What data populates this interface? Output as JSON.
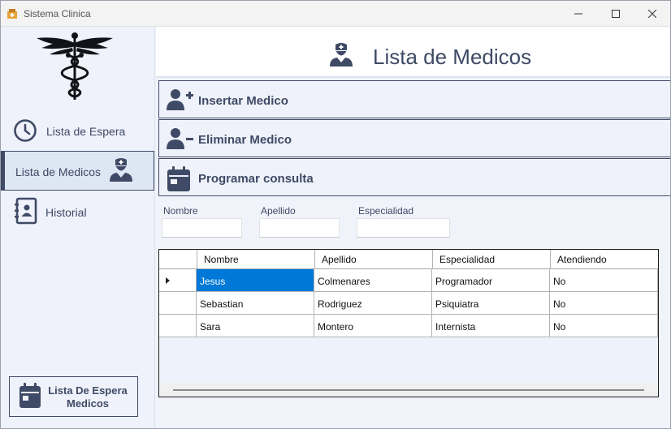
{
  "window": {
    "title": "Sistema Clinica",
    "controls": {
      "minimize": "─",
      "maximize": "☐",
      "close": "✕"
    }
  },
  "colors": {
    "accent": "#3f4a66",
    "selection": "#0078d7",
    "sidebar_bg": "#eff2fa",
    "active_nav_bg": "#dde6f3"
  },
  "sidebar": {
    "logo_icon": "caduceus-icon",
    "items": [
      {
        "label": "Lista de Espera",
        "icon": "clock-icon",
        "active": false
      },
      {
        "label": "Lista de Medicos",
        "icon": "doctor-icon",
        "active": true
      },
      {
        "label": "Historial",
        "icon": "address-book-icon",
        "active": false
      }
    ],
    "waitlist_button": {
      "label": "Lista De Espera Medicos",
      "icon": "calendar-icon"
    }
  },
  "header": {
    "title": "Lista de Medicos",
    "icon": "doctor-icon"
  },
  "actions": {
    "insert": {
      "label": "Insertar Medico",
      "icon": "user-plus-icon"
    },
    "delete": {
      "label": "Eliminar Medico",
      "icon": "user-minus-icon"
    },
    "schedule": {
      "label": "Programar consulta",
      "icon": "calendar-icon"
    }
  },
  "form": {
    "nombre": {
      "label": "Nombre",
      "value": ""
    },
    "apellido": {
      "label": "Apellido",
      "value": ""
    },
    "especialidad": {
      "label": "Especialidad",
      "value": ""
    }
  },
  "grid": {
    "columns": [
      "Nombre",
      "Apellido",
      "Especialidad",
      "Atendiendo"
    ],
    "rows": [
      [
        "Jesus",
        "Colmenares",
        "Programador",
        "No"
      ],
      [
        "Sebastian",
        "Rodriguez",
        "Psiquiatra",
        "No"
      ],
      [
        "Sara",
        "Montero",
        "Internista",
        "No"
      ]
    ],
    "selected_row": 0
  }
}
